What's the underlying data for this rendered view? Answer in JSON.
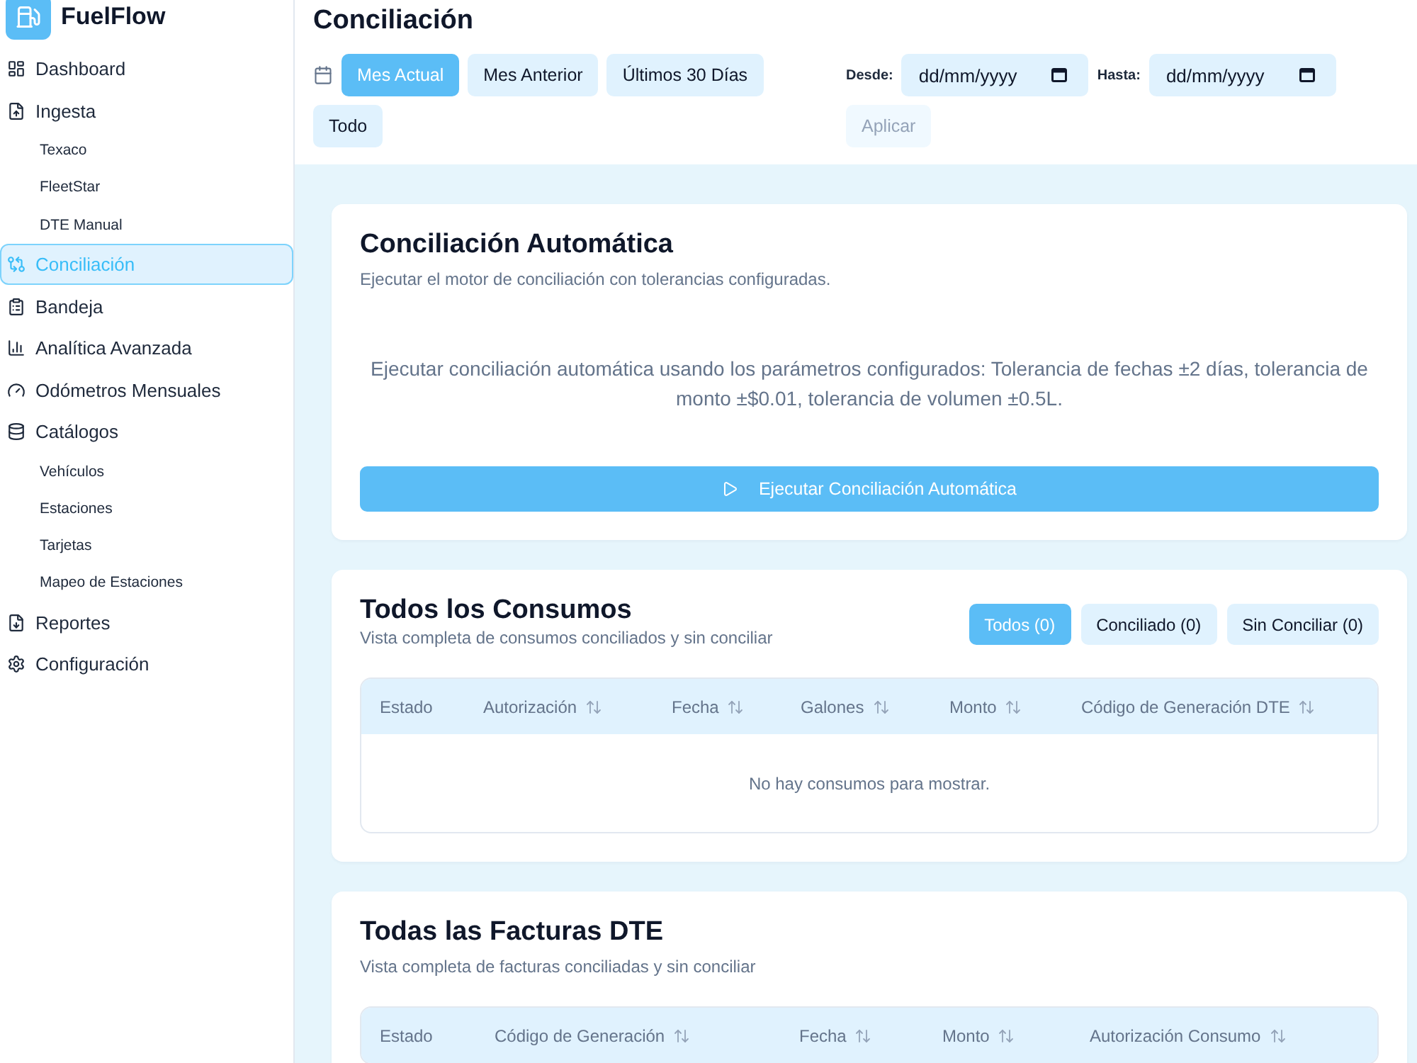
{
  "sidebar": {
    "logo": "FuelFlow",
    "items": [
      {
        "label": "Dashboard",
        "selected": false
      },
      {
        "label": "Ingesta",
        "selected": false,
        "children": [
          {
            "label": "Texaco",
            "selected": false
          },
          {
            "label": "FleetStar",
            "selected": false
          },
          {
            "label": "DTE Manual",
            "selected": false
          }
        ]
      },
      {
        "label": "Conciliación",
        "selected": true
      },
      {
        "label": "Bandeja",
        "selected": false
      },
      {
        "label": "Analítica Avanzada",
        "selected": false
      },
      {
        "label": "Odómetros Mensuales",
        "selected": false
      },
      {
        "label": "Catálogos",
        "selected": false,
        "children": [
          {
            "label": "Vehículos",
            "selected": false
          },
          {
            "label": "Estaciones",
            "selected": false
          },
          {
            "label": "Tarjetas",
            "selected": false
          },
          {
            "label": "Mapeo de Estaciones",
            "selected": false
          }
        ]
      },
      {
        "label": "Reportes",
        "selected": false
      },
      {
        "label": "Configuración",
        "selected": false
      }
    ]
  },
  "header": {
    "title": "Conciliación",
    "presets": [
      {
        "label": "Mes Actual",
        "selected": true
      },
      {
        "label": "Mes Anterior",
        "selected": false
      },
      {
        "label": "Últimos 30 Días",
        "selected": false
      },
      {
        "label": "Todo",
        "selected": false
      }
    ],
    "date_from": {
      "label": "Desde:",
      "placeholder": "dd/mm/yyyy"
    },
    "date_to": {
      "label": "Hasta:",
      "placeholder": "dd/mm/yyyy"
    },
    "apply": {
      "label": "Aplicar",
      "disabled": true
    }
  },
  "auto_reconciliation": {
    "title": "Conciliación Automática",
    "subtitle": "Ejecutar el motor de conciliación con tolerancias configuradas.",
    "description": "Ejecutar conciliación automática usando los parámetros configurados: Tolerancia de fechas ±2 días, tolerancia de monto ±$0.01, tolerancia de volumen ±0.5L.",
    "button": "Ejecutar Conciliación Automática"
  },
  "sections": [
    {
      "title": "Todos los Consumos",
      "subtitle": "Vista completa de consumos conciliados y sin conciliar",
      "filters": [
        {
          "label": "Todos (0)",
          "selected": true
        },
        {
          "label": "Conciliado (0)",
          "selected": false
        },
        {
          "label": "Sin Conciliar (0)",
          "selected": false
        }
      ],
      "table": {
        "columns": [
          {
            "label": "Estado",
            "sortable": false
          },
          {
            "label": "Autorización",
            "sortable": true
          },
          {
            "label": "Fecha",
            "sortable": true
          },
          {
            "label": "Galones",
            "sortable": true
          },
          {
            "label": "Monto",
            "sortable": true
          },
          {
            "label": "Código de Generación DTE",
            "sortable": true
          }
        ],
        "empty_message": "No hay consumos para mostrar."
      }
    },
    {
      "title": "Todas las Facturas DTE",
      "subtitle": "Vista completa de facturas conciliadas y sin conciliar",
      "table": {
        "columns": [
          {
            "label": "Estado",
            "sortable": false
          },
          {
            "label": "Código de Generación",
            "sortable": true
          },
          {
            "label": "Fecha",
            "sortable": true
          },
          {
            "label": "Monto",
            "sortable": true
          },
          {
            "label": "Autorización Consumo",
            "sortable": true
          }
        ]
      }
    }
  ]
}
